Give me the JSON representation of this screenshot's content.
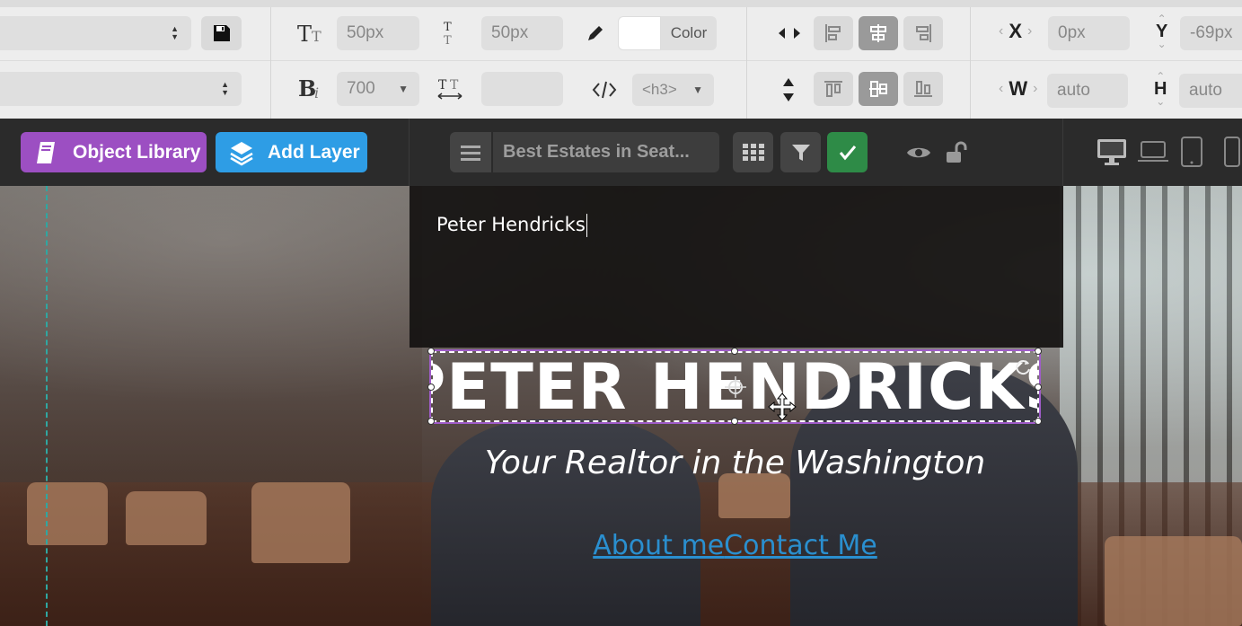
{
  "toolbar": {
    "font_select_value": "",
    "font_size": {
      "value": "50px"
    },
    "line_height": {
      "value": "50px"
    },
    "color": {
      "label": "Color",
      "value": "#ffffff"
    },
    "x": {
      "label": "X",
      "value": "0px"
    },
    "y": {
      "label": "Y",
      "value": "-69px"
    },
    "style_select_value": "",
    "font_weight": {
      "value": "700"
    },
    "letter_spacing": {
      "value": ""
    },
    "tag": {
      "value": "<h3>"
    },
    "w": {
      "label": "W",
      "value": "auto"
    },
    "h": {
      "label": "H",
      "value": "auto"
    },
    "h_align_active": "center",
    "v_align_active": "center"
  },
  "editor": {
    "object_library_label": "Object Library",
    "add_layer_label": "Add Layer",
    "layer_name": "Best Estates in Seat...",
    "colors": {
      "library": "#9c4fc2",
      "add_layer": "#2e9de5",
      "confirm": "#2e8b47"
    }
  },
  "canvas": {
    "text_editor_value": "Peter Hendricks",
    "heading": "PETER HENDRICKS",
    "subtitle": "Your Realtor in the Washington",
    "link_about": "About me",
    "link_contact": "Contact Me",
    "colors": {
      "selection": "#a05cc9",
      "guide": "#2fa7a1",
      "link": "#2a8fcf"
    }
  }
}
